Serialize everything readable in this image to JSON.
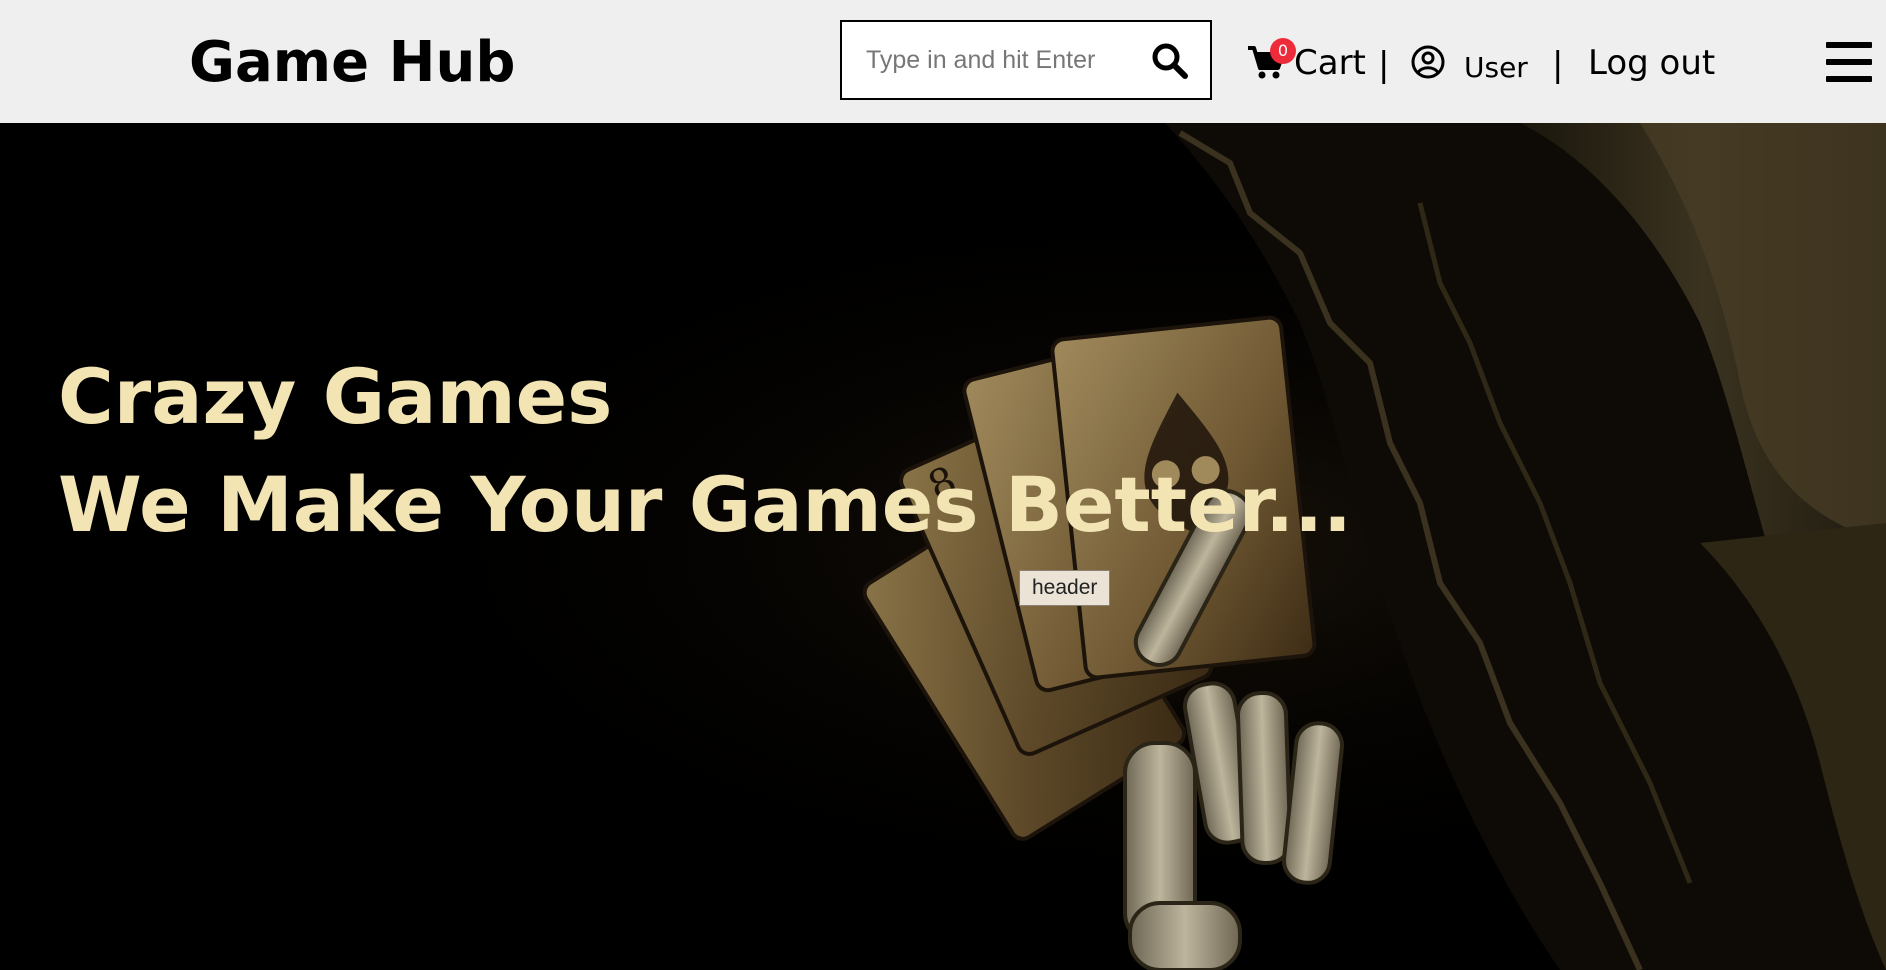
{
  "header": {
    "brand": "Game Hub",
    "search": {
      "placeholder": "Type in and hit Enter",
      "value": "",
      "icon": "search-icon"
    },
    "cart": {
      "label": "Cart",
      "count": "0",
      "icon": "cart-icon"
    },
    "separator": "|",
    "user": {
      "label": "User",
      "icon": "user-circle-icon"
    },
    "logout": {
      "label": "Log out"
    },
    "menu_icon": "hamburger-menu-icon"
  },
  "hero": {
    "title": "Crazy Games",
    "subtitle": "We Make Your Games Better...",
    "image": "skeleton-hand-holding-cards-illustration",
    "tooltip": "header",
    "text_color": "#f3e4b4"
  },
  "colors": {
    "topbar_bg": "#efefef",
    "badge_bg": "#ee2b3a",
    "hero_bg": "#000000"
  }
}
